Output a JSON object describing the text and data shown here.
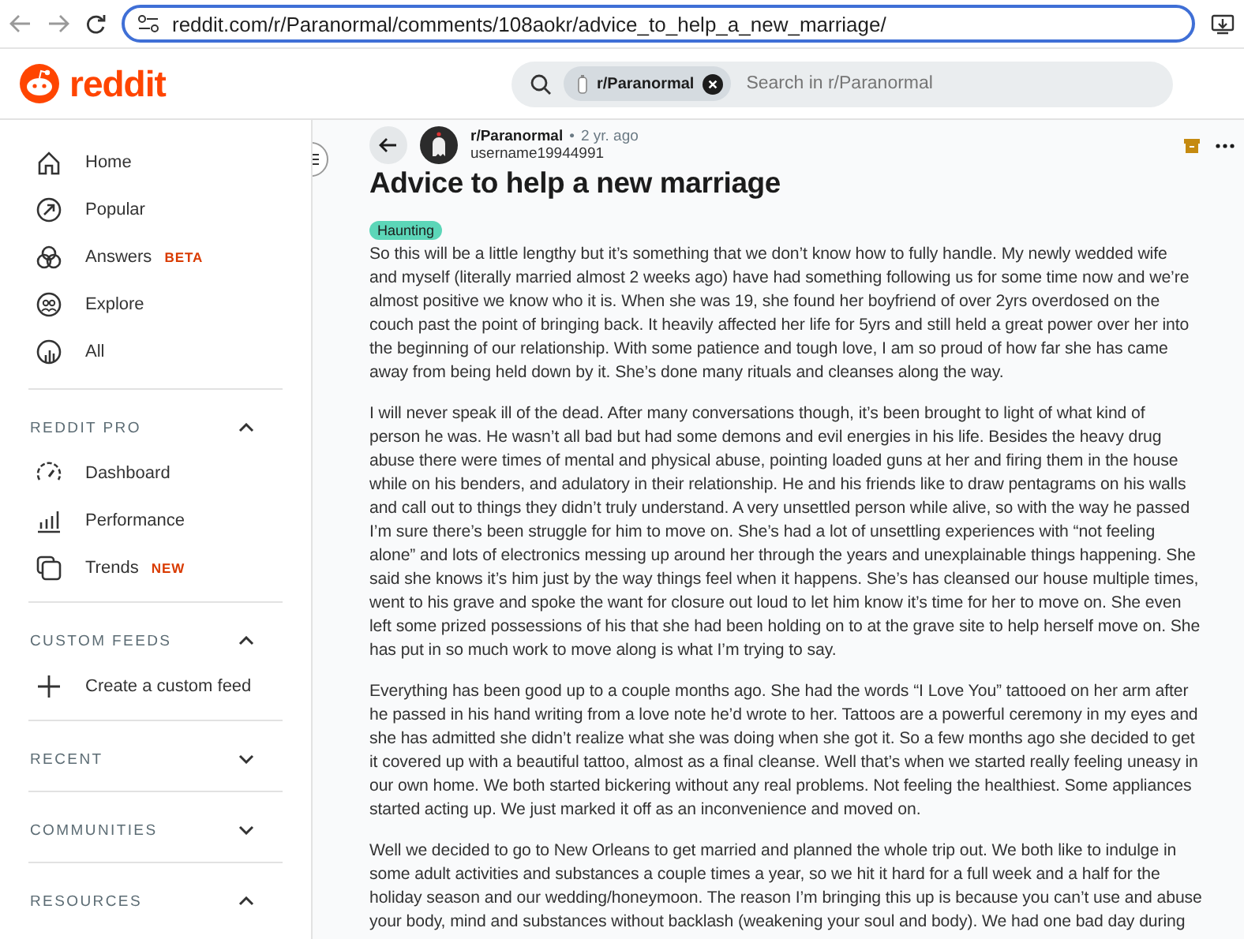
{
  "browser": {
    "url": "reddit.com/r/Paranormal/comments/108aokr/advice_to_help_a_new_marriage/"
  },
  "header": {
    "logo": "reddit",
    "search": {
      "chip": "r/Paranormal",
      "placeholder": "Search in r/Paranormal"
    }
  },
  "sidebar": {
    "items": [
      {
        "label": "Home"
      },
      {
        "label": "Popular"
      },
      {
        "label": "Answers",
        "badge": "BETA"
      },
      {
        "label": "Explore"
      },
      {
        "label": "All"
      }
    ],
    "sections": [
      {
        "title": "REDDIT PRO",
        "expanded": true,
        "items": [
          {
            "label": "Dashboard"
          },
          {
            "label": "Performance"
          },
          {
            "label": "Trends",
            "badge": "NEW"
          }
        ]
      },
      {
        "title": "CUSTOM FEEDS",
        "expanded": true,
        "items": [
          {
            "label": "Create a custom feed"
          }
        ]
      },
      {
        "title": "RECENT",
        "expanded": false
      },
      {
        "title": "COMMUNITIES",
        "expanded": false
      },
      {
        "title": "RESOURCES",
        "expanded": true
      }
    ]
  },
  "post": {
    "community": "r/Paranormal",
    "separator": "•",
    "time": "2 yr. ago",
    "author": "username19944991",
    "title": "Advice to help a new marriage",
    "flair": "Haunting",
    "paragraphs": [
      {
        "lines": [
          "So this will be a little lengthy but it’s something that we don’t know how to fully handle. My newly wedded wife",
          "and myself (literally married almost 2 weeks ago) have had something following us for some time now and we’re",
          "almost positive we know who it is. When she was 19, she found her boyfriend of over 2yrs overdosed on the",
          "couch past the point of bringing back. It heavily affected her life for 5yrs and still held a great power over her into",
          "the beginning of our relationship. With some patience and tough love, I am so proud of how far she has came",
          "away from being held down by it. She’s done many rituals and cleanses along the way."
        ]
      },
      {
        "lines": [
          "I will never speak ill of the dead. After many conversations though, it’s been brought to light of what kind of",
          "person he was. He wasn’t all bad but had some demons and evil energies in his life. Besides the heavy drug",
          "abuse there were times of mental and physical abuse, pointing loaded guns at her and firing them in the house",
          "while on his benders, and adulatory in their relationship. He and his friends like to draw pentagrams on his walls",
          "and call out to things they didn’t truly understand. A very unsettled person while alive, so with the way he passed",
          "I’m sure there’s been struggle for him to move on. She’s had a lot of unsettling experiences with “not feeling",
          "alone” and lots of electronics messing up around her through the years and unexplainable things happening. She",
          "said she knows it’s him just by the way things feel when it happens. She’s has cleansed our house multiple times,",
          "went to his grave and spoke the want for closure out loud to let him know it’s time for her to move on. She even",
          "left some prized possessions of his that she had been holding on to at the grave site to help herself move on. She",
          "has put in so much work to move along is what I’m trying to say."
        ]
      },
      {
        "lines": [
          "Everything has been good up to a couple months ago. She had the words “I Love You” tattooed on her arm after",
          "he passed in his hand writing from a love note he’d wrote to her. Tattoos are a powerful ceremony in my eyes and",
          "she has admitted she didn’t realize what she was doing when she got it. So a few months ago she decided to get",
          "it covered up with a beautiful tattoo, almost as a final cleanse. Well that’s when we started really feeling uneasy in",
          "our own home. We both started bickering without any real problems. Not feeling the healthiest. Some appliances",
          "started acting up. We just marked it off as an inconvenience and moved on."
        ]
      },
      {
        "lines": [
          "Well we decided to go to New Orleans to get married and planned the whole trip out. We both like to indulge in",
          "some adult activities and substances a couple times a year, so we hit it hard for a full week and a half for the",
          "holiday season and our wedding/honeymoon. The reason I’m bringing this up is because you can’t use and abuse",
          "your body, mind and substances without backlash (weakening your soul and body). We had one bad day during"
        ]
      }
    ]
  }
}
